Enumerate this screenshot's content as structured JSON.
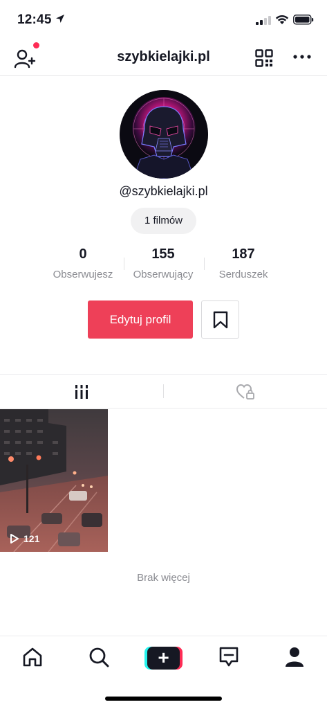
{
  "status_bar": {
    "time": "12:45",
    "location_icon": "location-arrow-icon",
    "signal_icon": "cellular-signal-icon",
    "wifi_icon": "wifi-icon",
    "battery_icon": "battery-icon"
  },
  "top_nav": {
    "username": "szybkielajki.pl",
    "add_user_icon": "add-user-icon",
    "qr_icon": "qr-code-icon",
    "more_icon": "more-dots-icon",
    "notification_color": "#fe2c55"
  },
  "profile": {
    "avatar": "darth-vader-avatar",
    "handle": "@szybkielajki.pl",
    "videos_count_label": "1 filmów"
  },
  "stats": [
    {
      "value": "0",
      "label": "Obserwujesz"
    },
    {
      "value": "155",
      "label": "Obserwujący"
    },
    {
      "value": "187",
      "label": "Serduszek"
    }
  ],
  "actions": {
    "edit_profile_label": "Edytuj profil",
    "edit_profile_color": "#ee4058",
    "bookmark_icon": "bookmark-icon"
  },
  "tabs": [
    {
      "name": "videos",
      "icon": "video-grid-icon",
      "active": true
    },
    {
      "name": "liked",
      "icon": "locked-heart-icon",
      "active": false
    }
  ],
  "videos": [
    {
      "views": "121",
      "thumbnail": "city-street-night"
    }
  ],
  "feed_end_label": "Brak więcej",
  "bottom_nav": [
    {
      "name": "home",
      "icon": "home-icon"
    },
    {
      "name": "discover",
      "icon": "search-icon"
    },
    {
      "name": "create",
      "icon": "plus-icon"
    },
    {
      "name": "inbox",
      "icon": "inbox-icon"
    },
    {
      "name": "profile",
      "icon": "profile-icon",
      "active": true
    }
  ]
}
